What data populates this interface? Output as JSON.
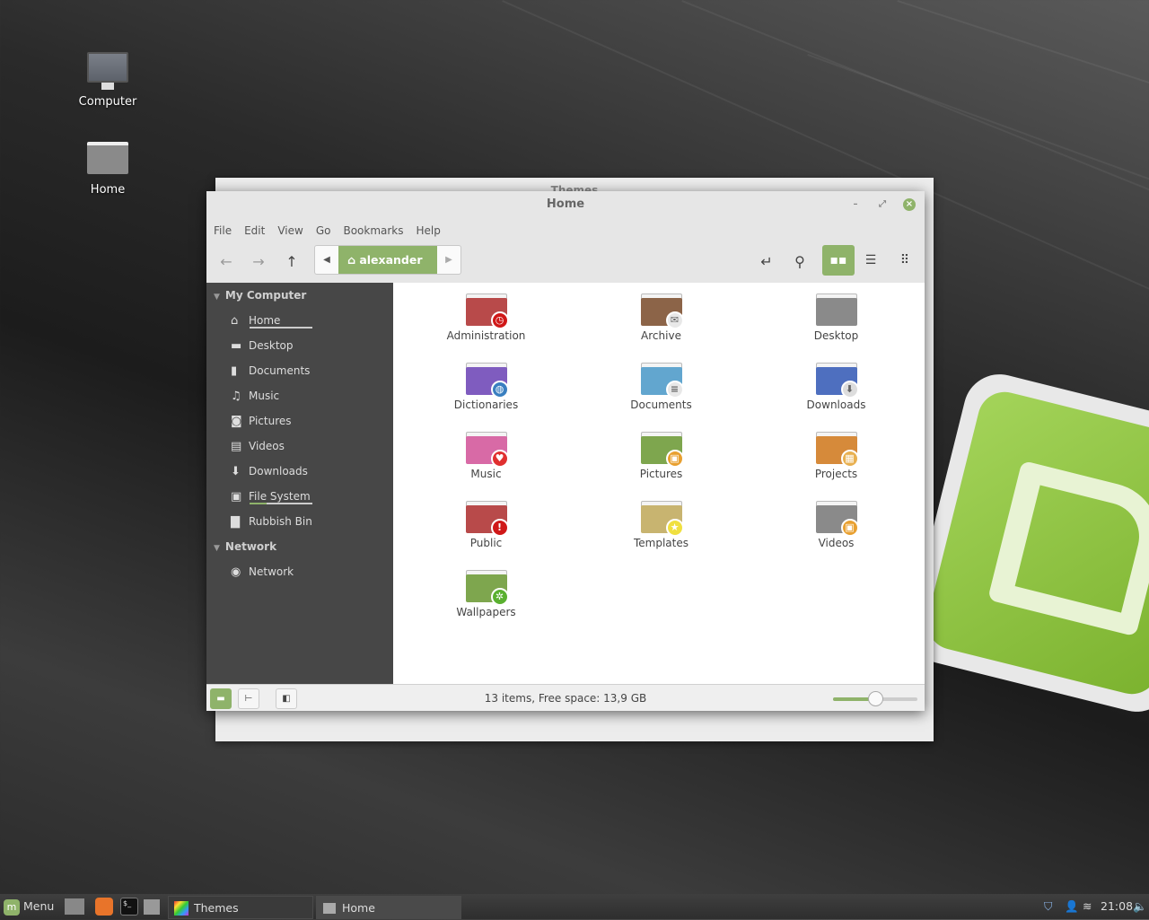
{
  "desktop": {
    "icons": [
      {
        "label": "Computer",
        "icon": "computer-icon"
      },
      {
        "label": "Home",
        "icon": "home-folder-icon"
      }
    ]
  },
  "back_window": {
    "title": "Themes"
  },
  "window": {
    "title": "Home",
    "menu": [
      "File",
      "Edit",
      "View",
      "Go",
      "Bookmarks",
      "Help"
    ],
    "path": {
      "current": "alexander"
    },
    "sidebar": {
      "sections": [
        {
          "title": "My Computer",
          "items": [
            {
              "label": "Home",
              "icon": "home-icon",
              "glyph": "⌂",
              "usage": 0
            },
            {
              "label": "Desktop",
              "icon": "desktop-icon",
              "glyph": "▬"
            },
            {
              "label": "Documents",
              "icon": "document-icon",
              "glyph": "▮"
            },
            {
              "label": "Music",
              "icon": "music-icon",
              "glyph": "♫"
            },
            {
              "label": "Pictures",
              "icon": "camera-icon",
              "glyph": "◙"
            },
            {
              "label": "Videos",
              "icon": "film-icon",
              "glyph": "▤"
            },
            {
              "label": "Downloads",
              "icon": "download-icon",
              "glyph": "⬇"
            },
            {
              "label": "File System",
              "icon": "drive-icon",
              "glyph": "▣",
              "usage": 0.27
            },
            {
              "label": "Rubbish Bin",
              "icon": "trash-icon",
              "glyph": "▇"
            }
          ]
        },
        {
          "title": "Network",
          "items": [
            {
              "label": "Network",
              "icon": "globe-icon",
              "glyph": "◉"
            }
          ]
        }
      ]
    },
    "files": [
      {
        "name": "Administration",
        "color": "#b84a4a",
        "emblem": "#d01818",
        "emblem_glyph": "◷"
      },
      {
        "name": "Archive",
        "color": "#8c6448",
        "emblem": "#e8e8e8",
        "emblem_glyph": "✉"
      },
      {
        "name": "Desktop",
        "color": "#8a8a8a"
      },
      {
        "name": "Dictionaries",
        "color": "#7f5cbf",
        "emblem": "#3a7fc0",
        "emblem_glyph": "◍"
      },
      {
        "name": "Documents",
        "color": "#62a6cf",
        "emblem": "#e8e8e8",
        "emblem_glyph": "≡"
      },
      {
        "name": "Downloads",
        "color": "#4e6fbf",
        "emblem": "#dddddd",
        "emblem_glyph": "⬇"
      },
      {
        "name": "Music",
        "color": "#d86aa6",
        "emblem": "#e03030",
        "emblem_glyph": "♥"
      },
      {
        "name": "Pictures",
        "color": "#7ea64e",
        "emblem": "#e8a030",
        "emblem_glyph": "▣"
      },
      {
        "name": "Projects",
        "color": "#d68a3a",
        "emblem": "#e8b050",
        "emblem_glyph": "▦"
      },
      {
        "name": "Public",
        "color": "#b84a4a",
        "emblem": "#d01818",
        "emblem_glyph": "!"
      },
      {
        "name": "Templates",
        "color": "#c8b470",
        "emblem": "#f0e040",
        "emblem_glyph": "★"
      },
      {
        "name": "Videos",
        "color": "#8a8a8a",
        "emblem": "#e8a030",
        "emblem_glyph": "▣"
      },
      {
        "name": "Wallpapers",
        "color": "#7ea64e",
        "emblem": "#5ab030",
        "emblem_glyph": "✲"
      }
    ],
    "status": {
      "text": "13 items, Free space: 13,9 GB",
      "zoom_level": 0.5
    }
  },
  "taskbar": {
    "menu_label": "Menu",
    "windows": [
      {
        "label": "Themes"
      },
      {
        "label": "Home"
      }
    ],
    "clock": "21:08"
  },
  "colors": {
    "accent": "#8fb36a"
  }
}
